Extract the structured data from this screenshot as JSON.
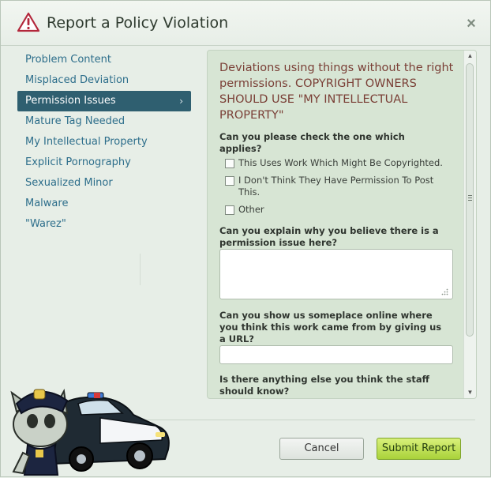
{
  "dialog": {
    "title": "Report a Policy Violation",
    "close_symbol": "×"
  },
  "sidebar": {
    "items": [
      {
        "label": "Problem Content"
      },
      {
        "label": "Misplaced Deviation"
      },
      {
        "label": "Permission Issues",
        "active": true,
        "chevron": "›"
      },
      {
        "label": "Mature Tag Needed"
      },
      {
        "label": "My Intellectual Property"
      },
      {
        "label": "Explicit Pornography"
      },
      {
        "label": "Sexualized Minor"
      },
      {
        "label": "Malware"
      },
      {
        "label": "\"Warez\""
      }
    ]
  },
  "form": {
    "intro": "Deviations using things without the right permissions. COPYRIGHT OWNERS SHOULD USE \"MY INTELLECTUAL PROPERTY\"",
    "q1": "Can you please check the one which applies?",
    "options": [
      {
        "label": "This Uses Work Which Might Be Copyrighted.",
        "checked": false
      },
      {
        "label": "I Don't Think They Have Permission To Post This.",
        "checked": false
      },
      {
        "label": "Other",
        "checked": false
      }
    ],
    "q2": "Can you explain why you believe there is a permission issue here?",
    "q2_value": "",
    "q3": "Can you show us someplace online where you think this work came from by giving us a URL?",
    "q3_value": "",
    "q4": "Is there anything else you think the staff should know?"
  },
  "footer": {
    "cancel_label": "Cancel",
    "submit_label": "Submit Report"
  },
  "colors": {
    "accent_active": "#2f5f70",
    "link": "#2d6e8b",
    "intro_text": "#7a3f36",
    "submit": "#a9d23a"
  },
  "icons": {
    "title": "warning-triangle-icon",
    "close": "close-icon",
    "mascot": "police-mascot-illustration"
  }
}
